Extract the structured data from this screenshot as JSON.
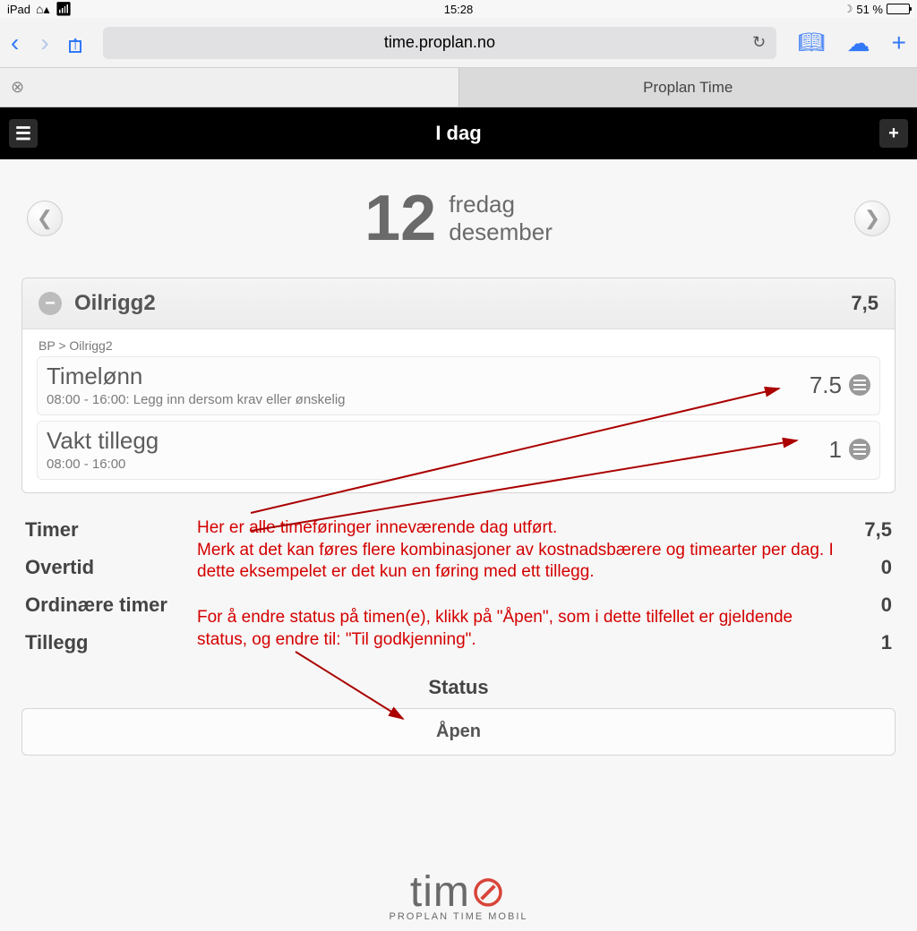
{
  "status_bar": {
    "device": "iPad",
    "time": "15:28",
    "battery_pct": "51 %"
  },
  "safari": {
    "url": "time.proplan.no"
  },
  "tabs": {
    "inactive": "",
    "active": "Proplan Time"
  },
  "app": {
    "title": "I dag"
  },
  "date": {
    "day_num": "12",
    "weekday": "fredag",
    "month": "desember"
  },
  "project": {
    "name": "Oilrigg2",
    "total": "7,5",
    "breadcrumb": "BP > Oilrigg2",
    "entries": [
      {
        "title": "Timelønn",
        "sub": "08:00 - 16:00: Legg inn dersom krav eller ønskelig",
        "value": "7.5"
      },
      {
        "title": "Vakt tillegg",
        "sub": "08:00 - 16:00",
        "value": "1"
      }
    ]
  },
  "summary": {
    "rows": [
      {
        "label": "Timer",
        "value": "7,5"
      },
      {
        "label": "Overtid",
        "value": "0"
      },
      {
        "label": "Ordinære timer",
        "value": "0"
      },
      {
        "label": "Tillegg",
        "value": "1"
      }
    ]
  },
  "status_section": {
    "heading": "Status",
    "value": "Åpen"
  },
  "annotations": {
    "block1": "Her er alle timeføringer inneværende dag utført.\nMerk at det kan føres flere kombinasjoner av kostnadsbærere og timearter per dag. I dette eksempelet er det kun en føring med ett tillegg.",
    "block2": "For å endre status på timen(e), klikk på \"Åpen\", som i dette tilfellet er gjeldende status, og endre til: \"Til godkjenning\"."
  },
  "footer": {
    "brand_pre": "tim",
    "brand_o": "⊘",
    "tagline": "PROPLAN TIME MOBIL"
  }
}
